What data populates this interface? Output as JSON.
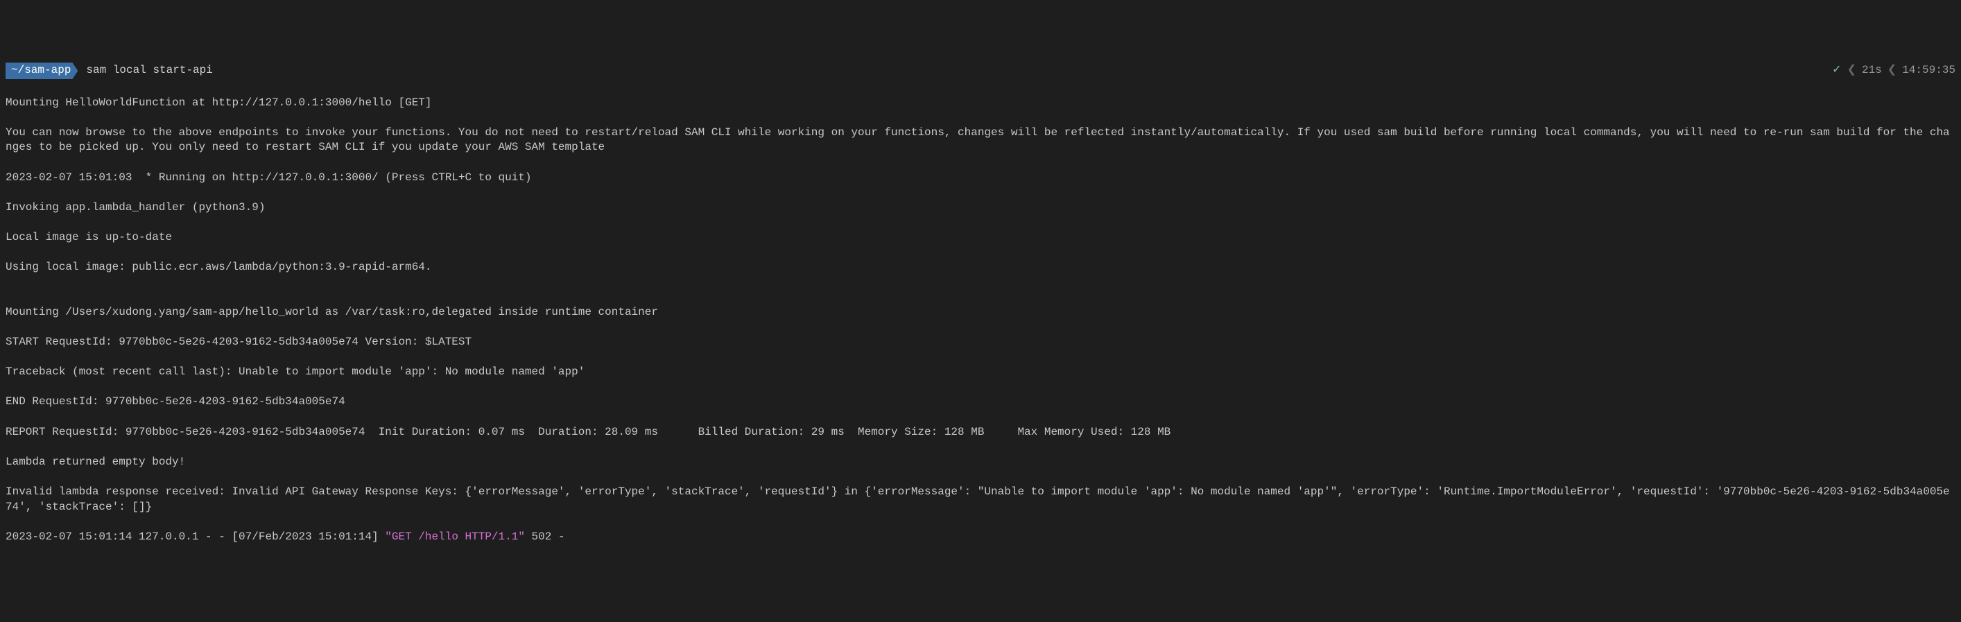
{
  "prompt": {
    "path": "~/sam-app",
    "command": "sam local start-api",
    "status_check": "✓",
    "duration": "21s",
    "time": "14:59:35"
  },
  "output": {
    "line1": "Mounting HelloWorldFunction at http://127.0.0.1:3000/hello [GET]",
    "line2": "You can now browse to the above endpoints to invoke your functions. You do not need to restart/reload SAM CLI while working on your functions, changes will be reflected instantly/automatically. If you used sam build before running local commands, you will need to re-run sam build for the changes to be picked up. You only need to restart SAM CLI if you update your AWS SAM template",
    "line3": "2023-02-07 15:01:03  * Running on http://127.0.0.1:3000/ (Press CTRL+C to quit)",
    "line4": "Invoking app.lambda_handler (python3.9)",
    "line5": "Local image is up-to-date",
    "line6": "Using local image: public.ecr.aws/lambda/python:3.9-rapid-arm64.",
    "line7": "",
    "line8": "Mounting /Users/xudong.yang/sam-app/hello_world as /var/task:ro,delegated inside runtime container",
    "line9": "START RequestId: 9770bb0c-5e26-4203-9162-5db34a005e74 Version: $LATEST",
    "line10": "Traceback (most recent call last): Unable to import module 'app': No module named 'app'",
    "line11": "END RequestId: 9770bb0c-5e26-4203-9162-5db34a005e74",
    "line12": "REPORT RequestId: 9770bb0c-5e26-4203-9162-5db34a005e74  Init Duration: 0.07 ms  Duration: 28.09 ms      Billed Duration: 29 ms  Memory Size: 128 MB     Max Memory Used: 128 MB",
    "line13": "Lambda returned empty body!",
    "line14": "Invalid lambda response received: Invalid API Gateway Response Keys: {'errorMessage', 'errorType', 'stackTrace', 'requestId'} in {'errorMessage': \"Unable to import module 'app': No module named 'app'\", 'errorType': 'Runtime.ImportModuleError', 'requestId': '9770bb0c-5e26-4203-9162-5db34a005e74', 'stackTrace': []}",
    "http_prefix": "2023-02-07 15:01:14 127.0.0.1 - - [07/Feb/2023 15:01:14] ",
    "http_method": "\"GET /hello HTTP/1.1\"",
    "http_suffix": " 502 -"
  }
}
